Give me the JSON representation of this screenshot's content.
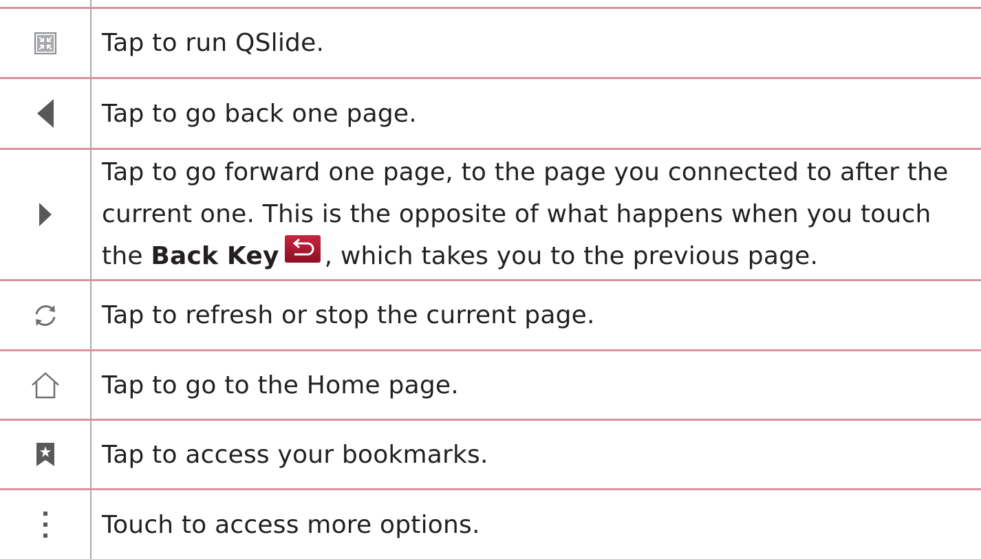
{
  "rows": [
    {
      "icon": "qslide-icon",
      "text": "Tap to run QSlide."
    },
    {
      "icon": "back-arrow-icon",
      "text": "Tap to go back one page."
    },
    {
      "icon": "forward-arrow-icon",
      "text_line1": "Tap to go forward one page, to the page you connected to after the",
      "text_line2": "current one. This is the opposite of what happens when you touch",
      "text_line3_before": "the ",
      "text_line3_bold": "Back Key",
      "text_line3_after": ", which takes you to the previous page.",
      "inline_icon": "back-key-icon"
    },
    {
      "icon": "refresh-icon",
      "text": "Tap to refresh or stop the current page."
    },
    {
      "icon": "home-icon",
      "text": "Tap to go to the Home page."
    },
    {
      "icon": "bookmark-icon",
      "text": "Tap to access your bookmarks."
    },
    {
      "icon": "more-options-icon",
      "text": "Touch to access more options."
    }
  ],
  "colors": {
    "rule": "#d9919c",
    "divider": "#a7a9ac",
    "icon_gray": "#6d6e71",
    "back_key_red": "#b0152f"
  }
}
